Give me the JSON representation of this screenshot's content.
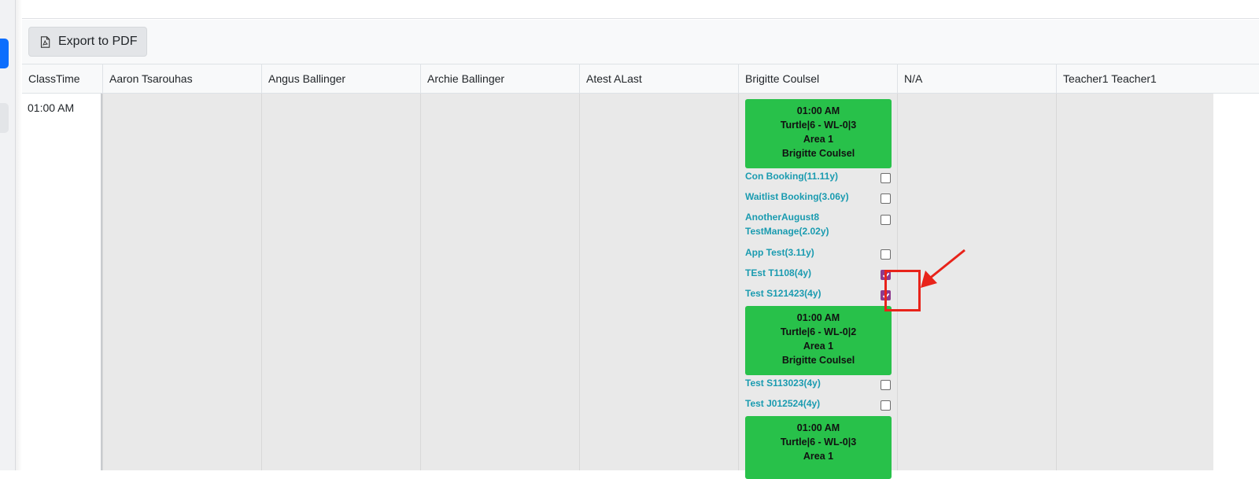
{
  "toolbar": {
    "export_label": "Export to PDF",
    "export_icon": "pdf-file-icon"
  },
  "grid": {
    "headers": [
      "ClassTime",
      "Aaron Tsarouhas",
      "Angus Ballinger",
      "Archie Ballinger",
      "Atest ALast",
      "Brigitte Coulsel",
      "N/A",
      "Teacher1 Teacher1"
    ],
    "time": "01:00 AM"
  },
  "slots": [
    {
      "time": "01:00 AM",
      "class": "Turtle|6 - WL-0|3",
      "area": "Area 1",
      "teacher": "Brigitte Coulsel"
    },
    {
      "time": "01:00 AM",
      "class": "Turtle|6 - WL-0|2",
      "area": "Area 1",
      "teacher": "Brigitte Coulsel"
    },
    {
      "time": "01:00 AM",
      "class": "Turtle|6 - WL-0|3",
      "area": "Area 1",
      "teacher": ""
    }
  ],
  "students": [
    {
      "name": "Con Booking(11.11y)",
      "checked": false
    },
    {
      "name": "Waitlist Booking(3.06y)",
      "checked": false
    },
    {
      "name": "AnotherAugust8 TestManage(2.02y)",
      "checked": false
    },
    {
      "name": "App Test(3.11y)",
      "checked": false
    },
    {
      "name": "TEst T1108(4y)",
      "checked": true
    },
    {
      "name": "Test S121423(4y)",
      "checked": true
    },
    {
      "name": "Test S113023(4y)",
      "checked": false
    },
    {
      "name": "Test J012524(4y)",
      "checked": false
    }
  ],
  "colors": {
    "slot_green": "#28c14a",
    "student_link": "#1a9bb0",
    "checkbox_checked": "#8e3a8e",
    "annotation_red": "#e8231a"
  }
}
